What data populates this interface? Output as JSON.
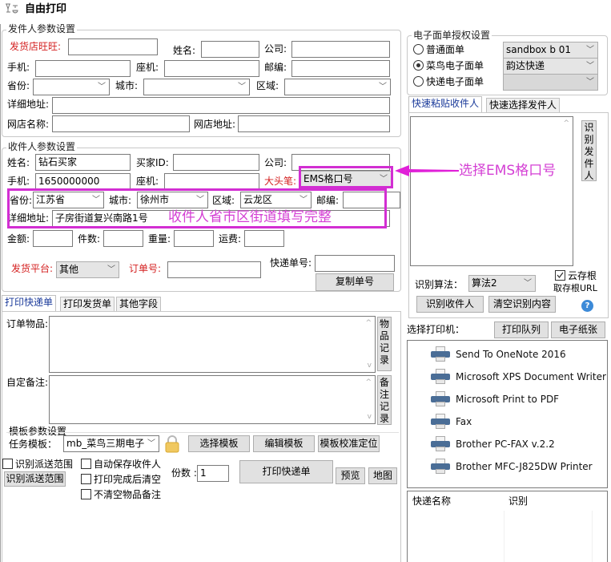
{
  "window": {
    "title": "自由打印",
    "icon": "print-settings-icon"
  },
  "sender": {
    "title": "发件人参数设置",
    "shop_wangwang_label": "发货店旺旺:",
    "shop_wangwang_value": "",
    "name_label": "姓名:",
    "name_value": "",
    "company_label": "公司:",
    "company_value": "",
    "mobile_label": "手机:",
    "mobile_value": "",
    "phone_label": "座机:",
    "phone_value": "",
    "zip_label": "邮编:",
    "zip_value": "",
    "province_label": "省份:",
    "province_value": "",
    "city_label": "城市:",
    "city_value": "",
    "district_label": "区域:",
    "district_value": "",
    "address_label": "详细地址:",
    "address_value": "",
    "shop_name_label": "网店名称:",
    "shop_name_value": "",
    "shop_url_label": "网店地址:",
    "shop_url_value": ""
  },
  "receiver": {
    "title": "收件人参数设置",
    "name_label": "姓名:",
    "name_value": "钻石买家",
    "buyer_id_label": "买家ID:",
    "buyer_id_value": "",
    "company_label": "公司:",
    "company_value": "",
    "mobile_label": "手机:",
    "mobile_value": "1650000000",
    "phone_label": "座机:",
    "phone_value": "",
    "big_head_label": "大头笔:",
    "big_head_value": "EMS格口号",
    "province_label": "省份:",
    "province_value": "江苏省",
    "city_label": "城市:",
    "city_value": "徐州市",
    "district_label": "区域:",
    "district_value": "云龙区",
    "zip_label": "邮编:",
    "zip_value": "",
    "address_label": "详细地址:",
    "address_value": "子房街道复兴南路1号",
    "amount_label": "金额:",
    "amount_value": "",
    "count_label": "件数:",
    "count_value": "",
    "weight_label": "重量:",
    "weight_value": "",
    "freight_label": "运费:",
    "freight_value": "",
    "platform_label": "发货平台:",
    "platform_value": "其他",
    "order_no_label": "订单号:",
    "order_no_value": "",
    "tracking_label": "快递单号:",
    "tracking_value": "",
    "copy_button": "复制单号"
  },
  "annotations": {
    "select_ems": "选择EMS格口号",
    "fill_address": "收件人省市区街道填写完整",
    "highlight_color": "#d22ed2"
  },
  "print_tabs": [
    {
      "label": "打印快递单",
      "active": true
    },
    {
      "label": "打印发货单",
      "active": false
    },
    {
      "label": "其他字段",
      "active": false
    }
  ],
  "print_panel": {
    "items_label": "订单物品:",
    "items_value": "",
    "items_record_button": "物品记录",
    "remark_label": "自定备注:",
    "remark_value": "",
    "remark_record_button": "备注记录",
    "template_group_title": "模板参数设置",
    "task_template_label": "任务模板：",
    "task_template_value": "mb_菜鸟三期电子",
    "select_template_button": "选择模板",
    "edit_template_button": "编辑模板",
    "calibrate_button": "模板校准定位",
    "detect_range_checkbox": {
      "label": "识别派送范围",
      "checked": false
    },
    "detect_range_button": "识别派送范围",
    "auto_save_checkbox": {
      "label": "自动保存收件人",
      "checked": false
    },
    "clear_after_print_checkbox": {
      "label": "打印完成后清空",
      "checked": false
    },
    "keep_items_checkbox": {
      "label": "不清空物品备注",
      "checked": false
    },
    "copies_label": "份数 :",
    "copies_value": "1",
    "print_button": "打印快递单",
    "preview_button": "预览",
    "map_button": "地图"
  },
  "auth": {
    "title": "电子面单授权设置",
    "options": [
      {
        "label": "普通面单",
        "selected": false
      },
      {
        "label": "菜鸟电子面单",
        "selected": true
      },
      {
        "label": "快递电子面单",
        "selected": false
      }
    ],
    "account_value": "sandbox b 01",
    "carrier_value": "韵达快递",
    "third_value": ""
  },
  "quick_tabs": [
    {
      "label": "快速粘贴收件人",
      "active": true
    },
    {
      "label": "快速选择发件人",
      "active": false
    }
  ],
  "recognize": {
    "paste_value": "",
    "recognize_sender_button": "识别发件人",
    "algo_label": "识别算法：",
    "algo_value": "算法2",
    "cloud_checkbox": {
      "label": "云存根",
      "checked": true
    },
    "cloud_url_label": "取存根URL",
    "recognize_receiver_button": "识别收件人",
    "clear_button": "清空识别内容",
    "help_icon": "help-icon"
  },
  "printer": {
    "select_label": "选择打印机：",
    "queue_button": "打印队列",
    "paper_button": "电子纸张",
    "printers": [
      "Send To OneNote 2016",
      "Microsoft XPS Document Writer",
      "Microsoft Print to PDF",
      "Fax",
      "Brother PC-FAX v.2.2",
      "Brother MFC-J825DW Printer"
    ]
  },
  "carrier_table": {
    "columns": [
      "快递名称",
      "识别"
    ],
    "rows": []
  }
}
